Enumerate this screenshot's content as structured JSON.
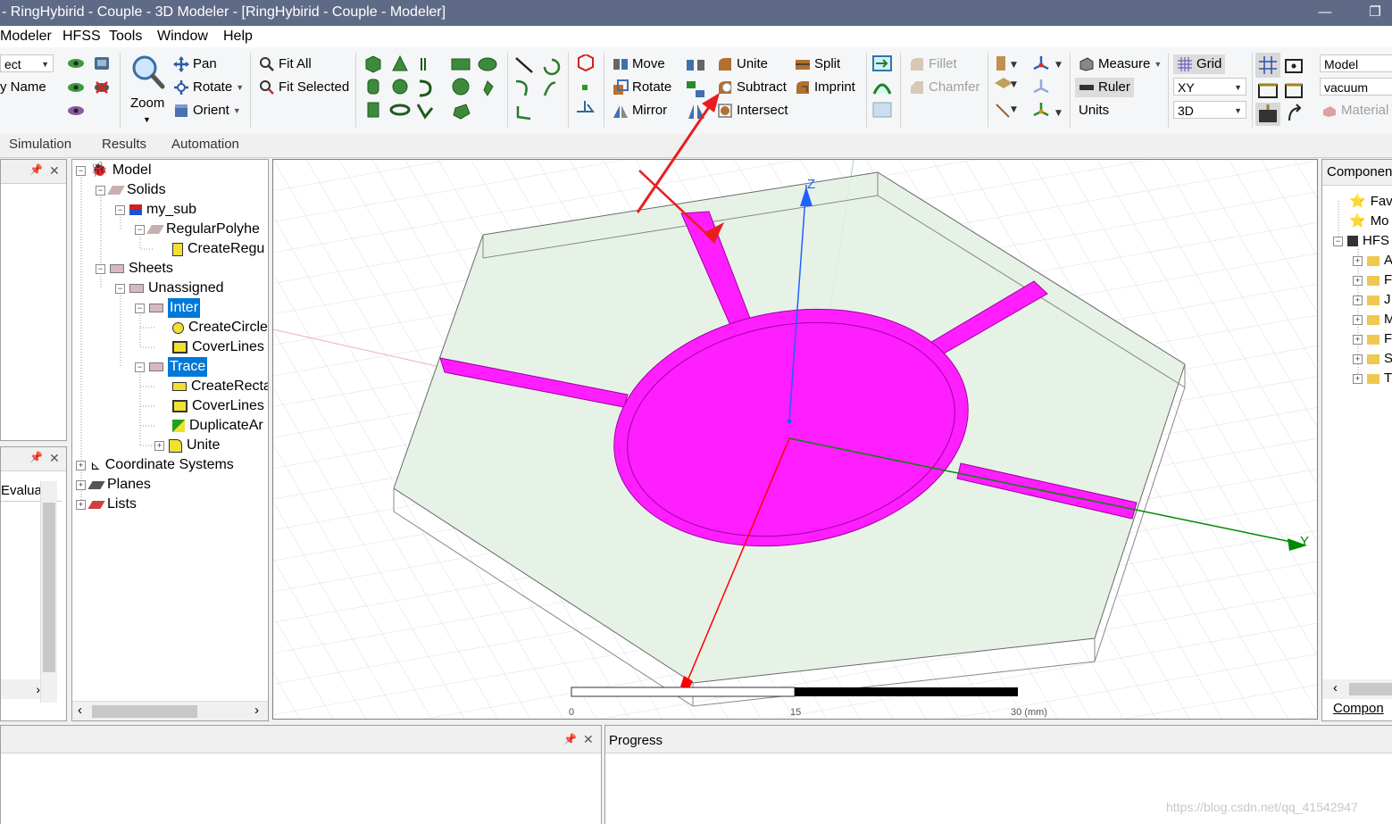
{
  "window": {
    "title": "- RingHybirid - Couple - 3D Modeler - [RingHybirid - Couple - Modeler]",
    "minimize": "—",
    "restore": "❐"
  },
  "menu": [
    "Modeler",
    "HFSS",
    "Tools",
    "Window",
    "Help"
  ],
  "ribbon": {
    "select_dropdown": "ect",
    "by_name": "y Name",
    "zoom": "Zoom",
    "pan": "Pan",
    "rotate_view": "Rotate",
    "orient": "Orient",
    "fit_all": "Fit All",
    "fit_selected": "Fit Selected",
    "move": "Move",
    "rotate": "Rotate",
    "mirror": "Mirror",
    "unite": "Unite",
    "subtract": "Subtract",
    "intersect": "Intersect",
    "split": "Split",
    "imprint": "Imprint",
    "fillet": "Fillet",
    "chamfer": "Chamfer",
    "measure": "Measure",
    "ruler": "Ruler",
    "units": "Units",
    "grid": "Grid",
    "plane": "XY",
    "dimension": "3D",
    "model_label": "Model",
    "material_value": "vacuum",
    "material": "Material"
  },
  "tabs": [
    "Simulation",
    "Results",
    "Automation"
  ],
  "left_panel": {
    "evaluate_label": "Evalua"
  },
  "tree": {
    "model": "Model",
    "solids": "Solids",
    "my_sub": "my_sub",
    "regular_polyhedron": "RegularPolyhe",
    "create_regular": "CreateRegu",
    "sheets": "Sheets",
    "unassigned": "Unassigned",
    "inter": "Inter",
    "create_circle": "CreateCircle",
    "cover_lines_1": "CoverLines",
    "trace": "Trace",
    "create_rect": "CreateRecta",
    "cover_lines_2": "CoverLines",
    "duplicate": "DuplicateAr",
    "unite": "Unite",
    "coordinate_systems": "Coordinate Systems",
    "planes": "Planes",
    "lists": "Lists"
  },
  "viewport": {
    "axis_z": "Z",
    "axis_y": "Y",
    "scale_ticks": [
      "0",
      "15",
      "30 (mm)"
    ]
  },
  "components": {
    "header": "Componen",
    "items": [
      "Fave",
      "Mo",
      "HFS"
    ],
    "subfolders": [
      "A",
      "F",
      "J",
      "M",
      "F",
      "S",
      "T"
    ],
    "footer_tab": "Compon"
  },
  "progress": {
    "header": "Progress"
  },
  "watermark": "https://blog.csdn.net/qq_41542947",
  "colors": {
    "accent_magenta": "#ff1eff",
    "selection_blue": "#0078d7",
    "axis_x": "#ff0000",
    "axis_y": "#009000",
    "axis_z": "#2060ff"
  }
}
